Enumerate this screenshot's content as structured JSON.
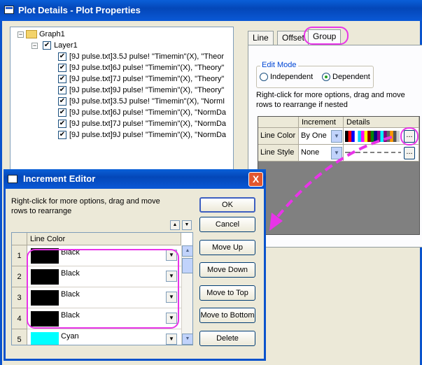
{
  "window": {
    "title": "Plot Details - Plot Properties"
  },
  "tree": {
    "graph": "Graph1",
    "layer": "Layer1",
    "items": [
      "[9J pulse.txt]3.5J pulse! \"Timemin\"(X), \"Theor",
      "[9J pulse.txt]6J pulse! \"Timemin\"(X), \"Theory\"",
      "[9J pulse.txt]7J pulse! \"Timemin\"(X), \"Theory\"",
      "[9J pulse.txt]9J pulse! \"Timemin\"(X), \"Theory\"",
      "[9J pulse.txt]3.5J pulse! \"Timemin\"(X), \"NormI",
      "[9J pulse.txt]6J pulse! \"Timemin\"(X), \"NormDa",
      "[9J pulse.txt]7J pulse! \"Timemin\"(X), \"NormDa",
      "[9J pulse.txt]9J pulse! \"Timemin\"(X), \"NormDa"
    ]
  },
  "tabs": [
    "Line",
    "Offset",
    "Group"
  ],
  "active_tab": "Group",
  "edit_mode": {
    "legend": "Edit Mode",
    "options": [
      "Independent",
      "Dependent"
    ],
    "selected": "Dependent"
  },
  "group_hint": {
    "line1": "Right-click for more options, drag and move",
    "line2": "rows to  rearrange if nested"
  },
  "group_grid": {
    "headers": [
      "Increment",
      "Details"
    ],
    "rows": [
      {
        "label": "Line Color",
        "increment": "By One",
        "details_button": "..."
      },
      {
        "label": "Line Style",
        "increment": "None",
        "details_button": "..."
      }
    ]
  },
  "increment_editor": {
    "title": "Increment Editor",
    "close": "X",
    "hint_line1": "Right-click for more options, drag and move",
    "hint_line2": "rows to  rearrange",
    "column_header": "Line Color",
    "rows": [
      {
        "num": "1",
        "color_name": "Black",
        "hex": "#000000"
      },
      {
        "num": "2",
        "color_name": "Black",
        "hex": "#000000"
      },
      {
        "num": "3",
        "color_name": "Black",
        "hex": "#000000"
      },
      {
        "num": "4",
        "color_name": "Black",
        "hex": "#000000"
      },
      {
        "num": "5",
        "color_name": "Cyan",
        "hex": "#00ffff"
      }
    ],
    "buttons": {
      "ok": "OK",
      "cancel": "Cancel",
      "move_up": "Move Up",
      "move_down": "Move Down",
      "move_to_top": "Move to Top",
      "move_to_bottom": "Move to Bottom",
      "delete": "Delete"
    }
  },
  "colors": {
    "annotation": "#e834e8",
    "titlebar": "#0a53cc",
    "swatch_strip": [
      "#000",
      "#f00",
      "#00f",
      "#fff",
      "#0cf",
      "#f0f",
      "#ff0",
      "#800",
      "#080",
      "#008",
      "#808",
      "#0ff",
      "#800080",
      "#666",
      "#f90",
      "#555",
      "#ccc"
    ]
  }
}
